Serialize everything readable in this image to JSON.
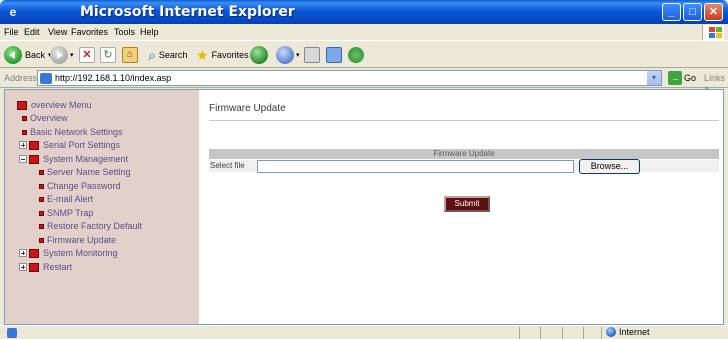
{
  "window": {
    "title": "Microsoft Internet Explorer",
    "minimize": "_",
    "maximize": "□",
    "close": "✕"
  },
  "menubar": {
    "items": [
      "File",
      "Edit",
      "View",
      "Favorites",
      "Tools",
      "Help"
    ]
  },
  "toolbar": {
    "back": "Back",
    "search": "Search",
    "favorites": "Favorites"
  },
  "address": {
    "label": "Address",
    "url": "http://192.168.1.10/index.asp",
    "go": "Go",
    "links": "Links",
    "links_chevron": "»"
  },
  "nav": {
    "root": "overview Menu",
    "overview": "Overview",
    "basic_network": "Basic Network Settings",
    "serial_port": "Serial Port Settings",
    "system_management": "System Management",
    "server_name": "Server Name Setting",
    "change_password": "Change Password",
    "email_alert": "E-mail Alert",
    "snmp_trap": "SNMP Trap",
    "restore_factory": "Restore Factory Default",
    "firmware_update": "Firmware Update",
    "system_monitoring": "System Monitoring",
    "restart": "Restart"
  },
  "main": {
    "page_title": "Firmware Update",
    "table_header": "Firmware Update",
    "select_file_label": "Select file",
    "file_value": "",
    "browse_label": "Browse...",
    "submit_label": "Submit"
  },
  "status": {
    "zone": "Internet"
  },
  "colors": {
    "nav_bg": "#e1d1ca",
    "nav_text": "#5a4e8a",
    "nav_bullet": "#c01818",
    "submit_bg": "#5e0f0f",
    "titlebar": "#0b58d6"
  }
}
